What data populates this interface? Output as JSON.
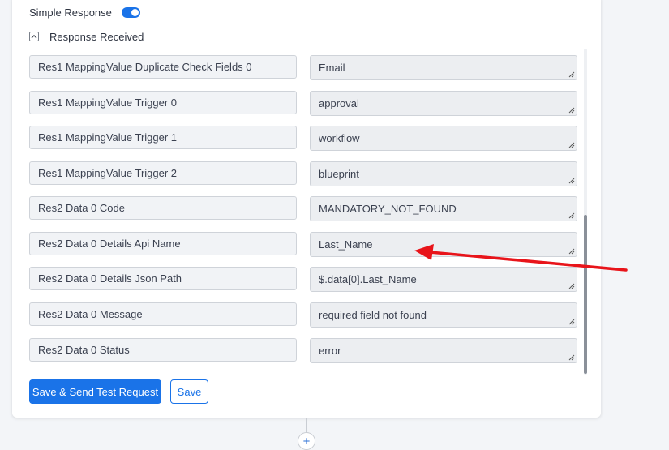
{
  "simple_response": {
    "label": "Simple Response",
    "enabled": true,
    "accent_color": "#1a73e8"
  },
  "response_section": {
    "label": "Response Received",
    "collapse_icon": "chevron-up-icon"
  },
  "fields": [
    {
      "label": "Res1 MappingValue Duplicate Check Fields 0",
      "value": "Email"
    },
    {
      "label": "Res1 MappingValue Trigger 0",
      "value": "approval"
    },
    {
      "label": "Res1 MappingValue Trigger 1",
      "value": "workflow"
    },
    {
      "label": "Res1 MappingValue Trigger 2",
      "value": "blueprint"
    },
    {
      "label": "Res2 Data 0 Code",
      "value": "MANDATORY_NOT_FOUND"
    },
    {
      "label": "Res2 Data 0 Details Api Name",
      "value": "Last_Name"
    },
    {
      "label": "Res2 Data 0 Details Json Path",
      "value": "$.data[0].Last_Name"
    },
    {
      "label": "Res2 Data 0 Message",
      "value": "required field not found"
    },
    {
      "label": "Res2 Data 0 Status",
      "value": "error"
    }
  ],
  "actions": {
    "save_send_label": "Save & Send Test Request",
    "save_label": "Save"
  },
  "annotation": {
    "type": "arrow",
    "color": "#e8141a",
    "points_to": "Res2 Data 0 Details Api Name"
  }
}
